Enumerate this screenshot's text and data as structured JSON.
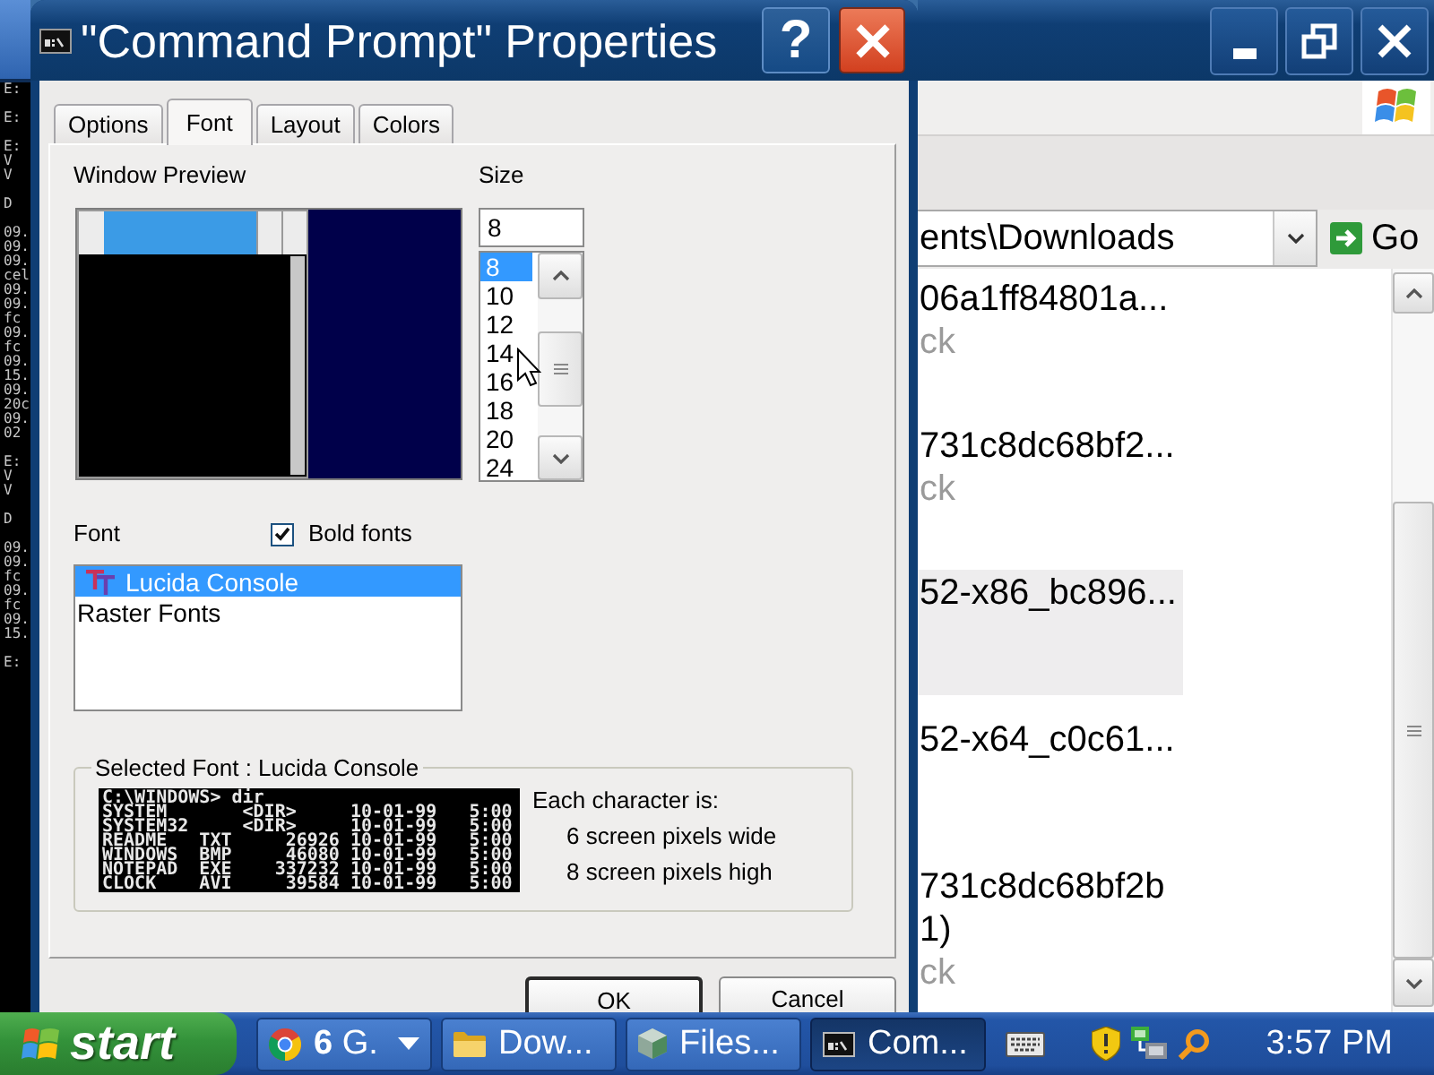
{
  "console_window": {
    "blocks": [
      [
        "E:"
      ],
      [
        "E:"
      ],
      [
        "E:",
        "V",
        "V"
      ],
      [
        "D"
      ],
      [
        "09.",
        "09.",
        "09.",
        "cel",
        "09.",
        "09.",
        "fc",
        "09.",
        "fc",
        "09.",
        "15.",
        "09.",
        "20c",
        "09.",
        "02"
      ],
      [
        "E:",
        "V",
        "V"
      ],
      [
        "D"
      ],
      [
        "09.",
        "09.",
        "fc",
        "09.",
        "fc",
        "09.",
        "15."
      ],
      [
        "E:"
      ]
    ]
  },
  "properties_dialog": {
    "title": "\"Command Prompt\" Properties",
    "help_button": {
      "label": "?"
    },
    "tabs": [
      {
        "label": "Options",
        "selected": false
      },
      {
        "label": "Font",
        "selected": true
      },
      {
        "label": "Layout",
        "selected": false
      },
      {
        "label": "Colors",
        "selected": false
      }
    ],
    "window_preview": {
      "label": "Window Preview"
    },
    "size": {
      "label": "Size",
      "value": "8",
      "options": [
        {
          "label": "8",
          "selected": true
        },
        {
          "label": "10",
          "selected": false
        },
        {
          "label": "12",
          "selected": false
        },
        {
          "label": "14",
          "selected": false
        },
        {
          "label": "16",
          "selected": false
        },
        {
          "label": "18",
          "selected": false
        },
        {
          "label": "20",
          "selected": false
        },
        {
          "label": "24",
          "selected": false
        }
      ]
    },
    "font": {
      "label": "Font",
      "bold_fonts": {
        "label": "Bold fonts",
        "checked": true
      },
      "options": [
        {
          "label": "Lucida Console",
          "kind": "truetype",
          "selected": true
        },
        {
          "label": "Raster Fonts",
          "kind": "raster",
          "selected": false
        }
      ]
    },
    "selected_font": {
      "title": "Selected Font : Lucida Console",
      "preview_lines": [
        "C:\\WINDOWS> dir",
        "SYSTEM       <DIR>     10-01-99   5:00",
        "SYSTEM32     <DIR>     10-01-99   5:00",
        "README   TXT     26926 10-01-99   5:00",
        "WINDOWS  BMP     46080 10-01-99   5:00",
        "NOTEPAD  EXE    337232 10-01-99   5:00",
        "CLOCK    AVI     39584 10-01-99   5:00"
      ],
      "description": {
        "heading": "Each character is:",
        "lines": [
          "6 screen pixels wide",
          "8 screen pixels high"
        ]
      }
    },
    "buttons": [
      {
        "label": "OK",
        "default": true
      },
      {
        "label": "Cancel",
        "default": false
      }
    ]
  },
  "explorer_window": {
    "address": {
      "value": "ents\\Downloads"
    },
    "go_button": {
      "label": "Go"
    },
    "items": [
      {
        "name_lines": [
          "06a1ff84801a..."
        ],
        "detail": "ck",
        "selected": false
      },
      {
        "name_lines": [
          "731c8dc68bf2..."
        ],
        "detail": "ck",
        "selected": false
      },
      {
        "name_lines": [
          "52-x86_bc896..."
        ],
        "selected": true
      },
      {
        "name_lines": [
          "52-x64_c0c61..."
        ],
        "selected": false
      },
      {
        "name_lines": [
          "731c8dc68bf2b",
          "1)"
        ],
        "detail": "ck",
        "selected": false
      }
    ]
  },
  "taskbar": {
    "start_button": {
      "label": "start"
    },
    "tasks": [
      {
        "kind": "browser",
        "label": "**6** G.",
        "grouped": true,
        "selected": false
      },
      {
        "kind": "folder",
        "label": "Dow...",
        "grouped": false,
        "selected": false
      },
      {
        "kind": "files",
        "label": "Files...",
        "grouped": false,
        "selected": false
      },
      {
        "kind": "console",
        "label": "Com...",
        "grouped": false,
        "selected": true
      }
    ],
    "clock": "3:57 PM"
  }
}
